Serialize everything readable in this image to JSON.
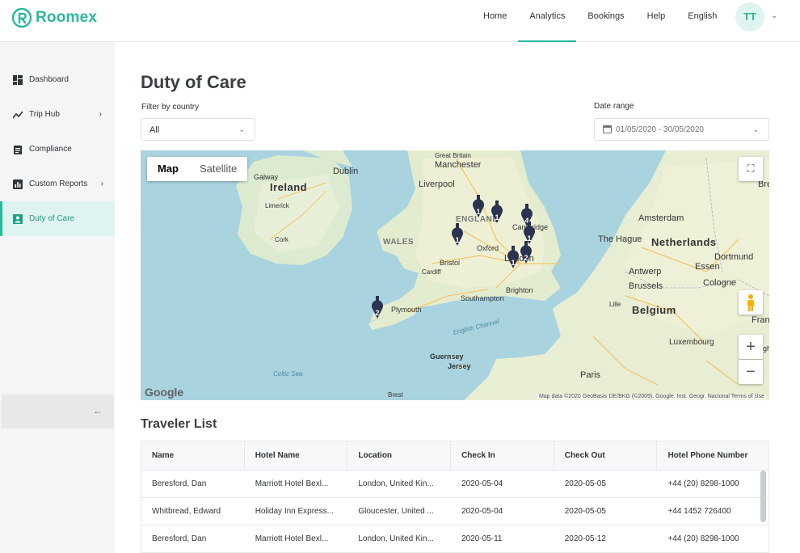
{
  "brand": {
    "name": "Roomex",
    "color": "#2bb89b"
  },
  "nav": {
    "items": [
      {
        "label": "Home"
      },
      {
        "label": "Analytics"
      },
      {
        "label": "Bookings"
      },
      {
        "label": "Help"
      },
      {
        "label": "English"
      }
    ],
    "active": "Analytics",
    "avatar_initials": "TT"
  },
  "sidebar": {
    "items": [
      {
        "label": "Dashboard",
        "icon": "dashboard-icon"
      },
      {
        "label": "Trip Hub",
        "icon": "trend-icon",
        "chevron": "›"
      },
      {
        "label": "Compliance",
        "icon": "clipboard-icon"
      },
      {
        "label": "Custom Reports",
        "icon": "bar-chart-icon",
        "chevron": "›"
      },
      {
        "label": "Duty of Care",
        "icon": "person-badge-icon",
        "active": true
      }
    ],
    "collapse_icon": "arrow-left-icon"
  },
  "page": {
    "title": "Duty of Care",
    "filter_label": "Filter by country",
    "filter_value": "All",
    "date_label": "Date range",
    "date_value": "01/05/2020 - 30/05/2020"
  },
  "map": {
    "type_map": "Map",
    "type_satellite": "Satellite",
    "labels": {
      "great_britain": "Great Britain",
      "manchester": "Manchester",
      "galway": "Galway",
      "dublin": "Dublin",
      "ireland": "Ireland",
      "liverpool": "Liverpool",
      "limerick": "Limerick",
      "england": "ENGLAND",
      "cambridge": "Cambridge",
      "amsterdam": "Amsterdam",
      "hague": "The Hague",
      "netherlands": "Netherlands",
      "cork": "Cork",
      "wales": "WALES",
      "oxford": "Oxford",
      "bristol": "Bristol",
      "cardiff": "Cardiff",
      "london": "London",
      "dortmund": "Dortmund",
      "antwerp": "Antwerp",
      "essen": "Essen",
      "brussels": "Brussels",
      "cologne": "Cologne",
      "brighton": "Brighton",
      "southampton": "Southampton",
      "plymouth": "Plymouth",
      "lille": "Lille",
      "belgium": "Belgium",
      "english_channel": "English Channel",
      "luxembourg": "Luxembourg",
      "guernsey": "Guernsey",
      "jersey": "Jersey",
      "celtic_sea": "Celtic Sea",
      "paris": "Paris",
      "brest": "Brest",
      "bre": "Bre",
      "fran": "Fran",
      "gh": "gh"
    },
    "pins": [
      {
        "count": "1"
      },
      {
        "count": "1"
      },
      {
        "count": "4"
      },
      {
        "count": "1"
      },
      {
        "count": "1"
      },
      {
        "count": "2"
      },
      {
        "count": "1"
      },
      {
        "count": "2"
      }
    ],
    "google": "Google",
    "attribution": "Map data ©2020 GeoBasis-DE/BKG (©2009), Google, Inst. Geogr. Nacional   Terms of Use"
  },
  "traveler_list": {
    "title": "Traveler List",
    "columns": [
      "Name",
      "Hotel Name",
      "Location",
      "Check In",
      "Check Out",
      "Hotel Phone Number"
    ],
    "rows": [
      [
        "Beresford, Dan",
        "Marriott Hotel Bexl...",
        "London, United Kin...",
        "2020-05-04",
        "2020-05-05",
        "+44 (20) 8298-1000"
      ],
      [
        "Whitbread, Edward",
        "Holiday Inn Express...",
        "Gloucester, United ...",
        "2020-05-04",
        "2020-05-05",
        "+44 1452 726400"
      ],
      [
        "Beresford, Dan",
        "Marriott Hotel Bexl...",
        "London, United Kin...",
        "2020-05-11",
        "2020-05-12",
        "+44 (20) 8298-1000"
      ]
    ]
  }
}
